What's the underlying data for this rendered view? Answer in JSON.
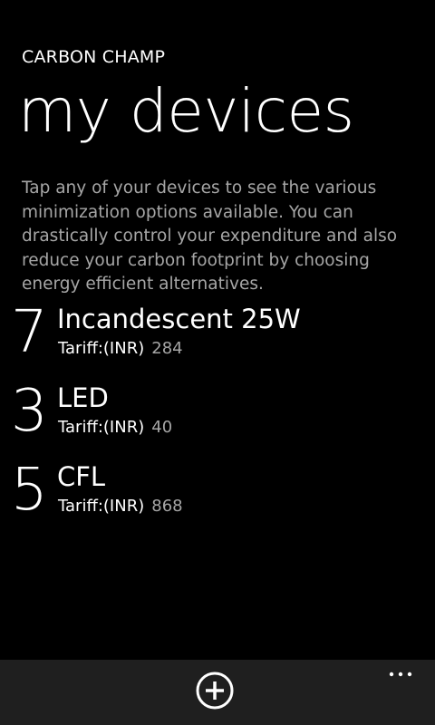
{
  "header": {
    "app_title": "CARBON CHAMP",
    "page_title": "my devices"
  },
  "main": {
    "description": "Tap any of your devices to see the various minimization options available. You can drastically control your expenditure and also reduce your carbon footprint by choosing energy efficient alternatives.",
    "devices": [
      {
        "quantity": "7",
        "name": "Incandescent 25W",
        "tariff_label": "Tariff:(INR)",
        "tariff_value": "284"
      },
      {
        "quantity": "3",
        "name": "LED",
        "tariff_label": "Tariff:(INR)",
        "tariff_value": "40"
      },
      {
        "quantity": "5",
        "name": "CFL",
        "tariff_label": "Tariff:(INR)",
        "tariff_value": "868"
      }
    ]
  },
  "app_bar": {
    "add_icon": "plus-circle-icon",
    "more_icon": "ellipsis-icon"
  },
  "colors": {
    "background": "#000000",
    "foreground": "#ffffff",
    "subtle_text": "#a6a6a6",
    "app_bar": "#1f1f1f"
  }
}
